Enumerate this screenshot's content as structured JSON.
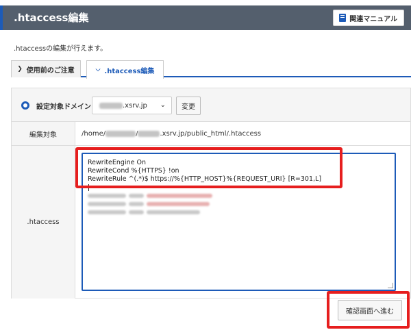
{
  "header": {
    "title": ".htaccess編集",
    "manual_label": "関連マニュアル",
    "manual_icon": "book-icon"
  },
  "description": ".htaccessの編集が行えます。",
  "tabs": [
    {
      "label": "使用前のご注意",
      "icon": "chevron-right-icon",
      "active": false
    },
    {
      "label": ".htaccess編集",
      "icon": "chevron-down-icon",
      "active": true
    }
  ],
  "form": {
    "domain_label": "設定対象ドメイン",
    "domain_value_suffix": ".xsrv.jp",
    "change_label": "変更",
    "target_label": "編集対象",
    "target_path": "/home/█████/█████.xsrv.jp/public_html/.htaccess",
    "target_prefix": "/home/",
    "target_suffix": ".xsrv.jp/public_html/.htaccess",
    "htaccess_label": ".htaccess",
    "code_lines": [
      "RewriteEngine On",
      "RewriteCond %{HTTPS} !on",
      "RewriteRule ^(.*)$ https://%{HTTP_HOST}%{REQUEST_URI} [R=301,L]"
    ]
  },
  "confirm_label": "確認画面へ進む",
  "colors": {
    "accent": "#1d5bb8",
    "header_bg": "#545f6d",
    "highlight": "#e61e1e"
  }
}
